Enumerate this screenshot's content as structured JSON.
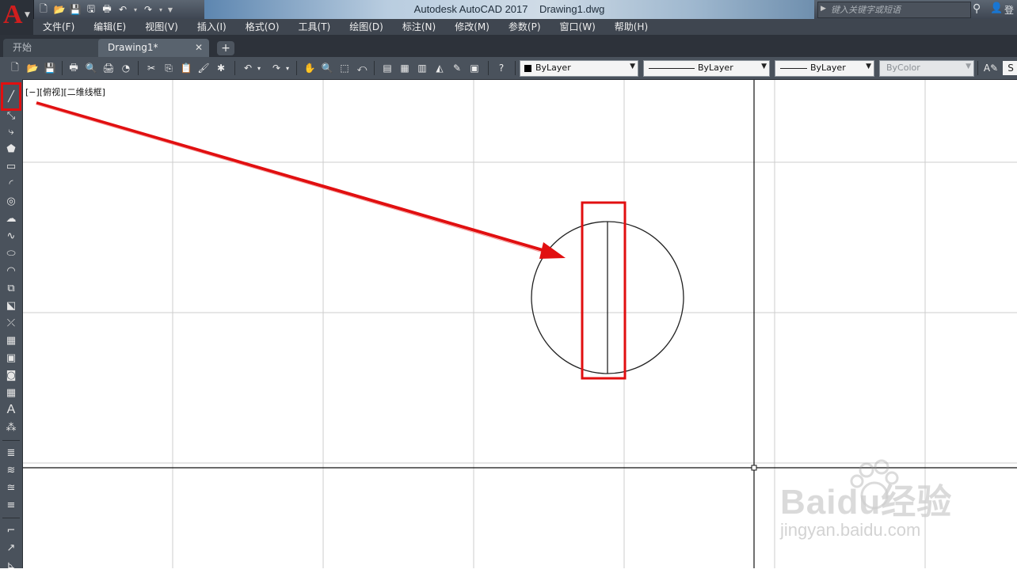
{
  "window": {
    "title": "Autodesk AutoCAD 2017    Drawing1.dwg",
    "search_placeholder": "键入关键字或短语"
  },
  "app_logo": {
    "letter": "A"
  },
  "quick_access": [
    {
      "icon": "new-file-icon",
      "glyph": "🗋"
    },
    {
      "icon": "open-folder-icon",
      "glyph": "📂"
    },
    {
      "icon": "save-icon",
      "glyph": "💾"
    },
    {
      "icon": "save-as-icon",
      "glyph": "🖫"
    },
    {
      "icon": "print-icon",
      "glyph": "🖶"
    },
    {
      "icon": "undo-icon",
      "glyph": "↶"
    },
    {
      "icon": "undo-dropdown-icon",
      "glyph": "▾"
    },
    {
      "icon": "redo-icon",
      "glyph": "↷"
    },
    {
      "icon": "redo-dropdown-icon",
      "glyph": "▾"
    },
    {
      "icon": "customize-dropdown-icon",
      "glyph": "▼"
    }
  ],
  "menu": [
    "文件(F)",
    "编辑(E)",
    "视图(V)",
    "插入(I)",
    "格式(O)",
    "工具(T)",
    "绘图(D)",
    "标注(N)",
    "修改(M)",
    "参数(P)",
    "窗口(W)",
    "帮助(H)"
  ],
  "tabs": {
    "start": "开始",
    "drawing": "Drawing1*",
    "close": "✕",
    "add": "+"
  },
  "properties": {
    "color": "ByLayer",
    "linetype": "ByLayer",
    "lineweight": "ByLayer",
    "plotstyle": "ByColor"
  },
  "viewport_label": "[−][俯视][二维线框]",
  "watermark": {
    "text": "Baidu经验",
    "url": "jingyan.baidu.com"
  },
  "colors": {
    "highlight_red": "#e10f10",
    "grid": "#cdcdcd",
    "geometry": "#222222"
  }
}
